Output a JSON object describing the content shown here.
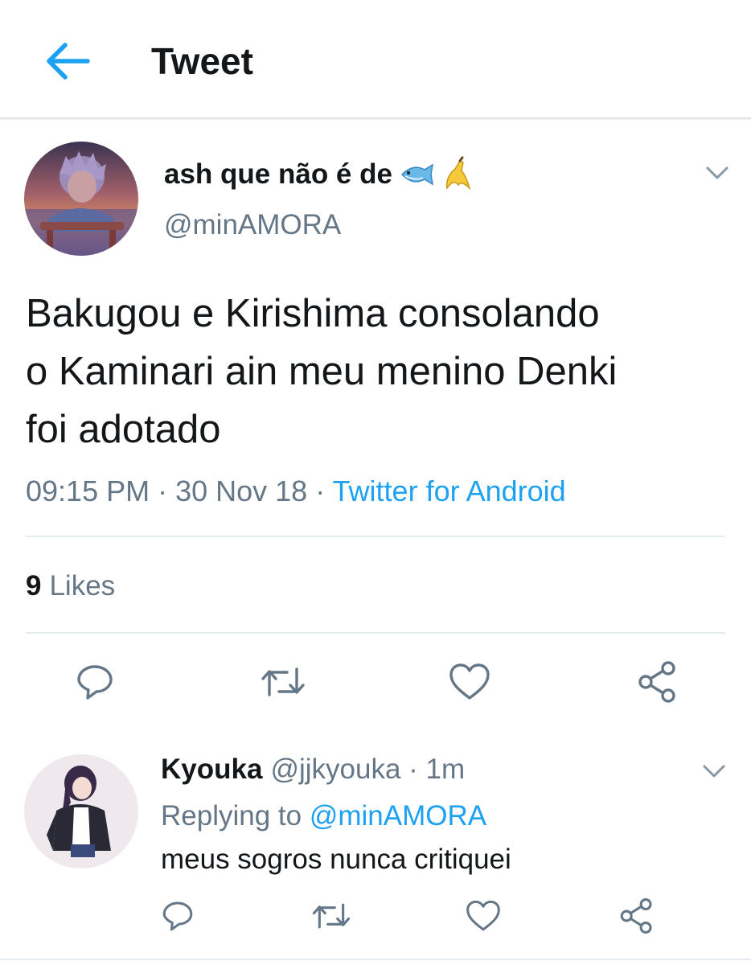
{
  "header": {
    "title": "Tweet",
    "accent_color": "#1da1f2"
  },
  "tweet": {
    "display_name": "ash que não é de",
    "name_emojis": [
      "fish-emoji",
      "banana-emoji"
    ],
    "handle": "@minAMORA",
    "text_lines": [
      "Bakugou e Kirishima consolando",
      "o Kaminari ain meu menino Denki",
      "foi adotado"
    ],
    "time": "09:15 PM",
    "sep1": " · ",
    "date": "30 Nov 18",
    "sep2": " · ",
    "source": "Twitter for Android",
    "likes_count": "9",
    "likes_label": "Likes",
    "actions": [
      "reply-icon",
      "retweet-icon",
      "like-icon",
      "share-icon"
    ]
  },
  "reply": {
    "name": "Kyouka",
    "handle": "@jjkyouka",
    "sep": " · ",
    "time": "1m",
    "replying_label": "Replying to ",
    "replying_to": "@minAMORA",
    "text": "meus sogros nunca critiquei",
    "actions": [
      "reply-icon",
      "retweet-icon",
      "like-icon",
      "share-icon"
    ]
  },
  "colors": {
    "text_primary": "#14171a",
    "text_secondary": "#657786",
    "link": "#1da1f2",
    "divider": "#e6ecf0",
    "icon": "#657786"
  }
}
